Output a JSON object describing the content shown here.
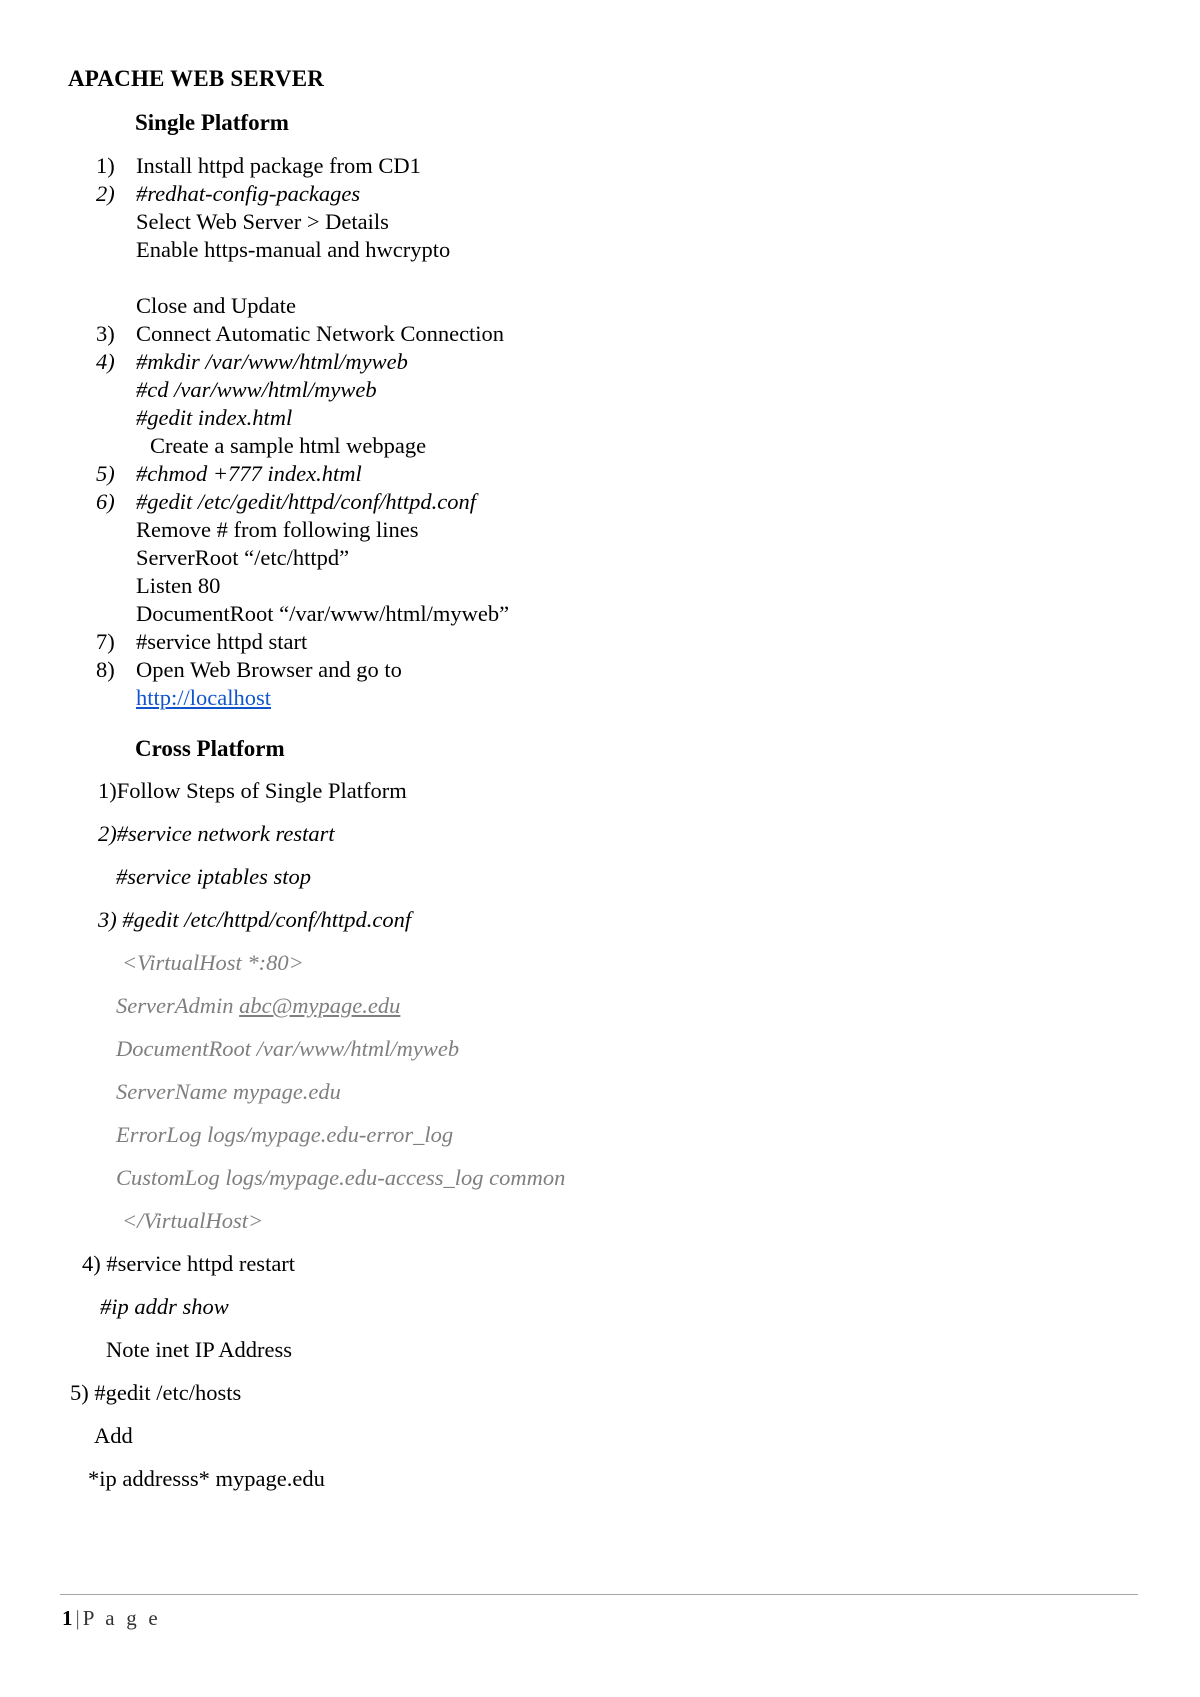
{
  "document": {
    "title": "APACHE WEB SERVER"
  },
  "sections": {
    "single": {
      "heading": "Single Platform",
      "items": [
        {
          "marker": "1)",
          "lines": [
            {
              "text": "Install httpd package from CD1",
              "style": "roman"
            }
          ]
        },
        {
          "marker": "2)",
          "lines": [
            {
              "text": "#redhat-config-packages",
              "style": "italic"
            },
            {
              "text": "Select Web Server > Details",
              "style": "roman"
            },
            {
              "text": "Enable https-manual and hwcrypto",
              "style": "roman"
            },
            {
              "text": "",
              "style": "blank"
            },
            {
              "text": "Close and Update",
              "style": "roman"
            }
          ]
        },
        {
          "marker": "3)",
          "lines": [
            {
              "text": "Connect Automatic Network Connection",
              "style": "roman"
            }
          ]
        },
        {
          "marker": "4)",
          "lines": [
            {
              "text": "#mkdir /var/www/html/myweb",
              "style": "italic"
            },
            {
              "text": "#cd /var/www/html/myweb",
              "style": "italic"
            },
            {
              "text": "#gedit index.html",
              "style": "italic"
            },
            {
              "text": "Create a sample html webpage",
              "style": "roman-indent"
            }
          ]
        },
        {
          "marker": "5)",
          "lines": [
            {
              "text": "#chmod +777 index.html",
              "style": "italic"
            }
          ]
        },
        {
          "marker": "6)",
          "lines": [
            {
              "text": "#gedit /etc/gedit/httpd/conf/httpd.conf",
              "style": "italic"
            },
            {
              "text": "Remove # from following lines",
              "style": "roman"
            },
            {
              "text": "ServerRoot “/etc/httpd”",
              "style": "roman"
            },
            {
              "text": "Listen 80",
              "style": "roman"
            },
            {
              "text": "DocumentRoot “/var/www/html/myweb”",
              "style": "roman"
            }
          ]
        },
        {
          "marker": "7)",
          "lines": [
            {
              "text": "#service httpd start",
              "style": "roman"
            }
          ]
        },
        {
          "marker": "8)",
          "lines": [
            {
              "text": "Open Web Browser and go to",
              "style": "roman"
            },
            {
              "text": "http://localhost",
              "style": "link"
            }
          ]
        }
      ]
    },
    "cross": {
      "heading": "Cross Platform",
      "lines": [
        {
          "text": "1)Follow Steps of Single Platform",
          "style": "roman",
          "indent": 30
        },
        {
          "text": "2)#service network restart",
          "style": "italic",
          "indent": 30
        },
        {
          "text": "#service iptables stop",
          "style": "italic",
          "indent": 48
        },
        {
          "text": "3) #gedit /etc/httpd/conf/httpd.conf",
          "style": "italic",
          "indent": 30
        },
        {
          "text": "<VirtualHost *:80>",
          "style": "gray",
          "indent": 54
        },
        {
          "text": "ServerAdmin abc@mypage.edu",
          "style": "gray-mail",
          "indent": 48,
          "link_text": "abc@mypage.edu",
          "prefix": "ServerAdmin "
        },
        {
          "text": "DocumentRoot /var/www/html/myweb",
          "style": "gray",
          "indent": 48
        },
        {
          "text": "ServerName mypage.edu",
          "style": "gray",
          "indent": 48
        },
        {
          "text": "ErrorLog logs/mypage.edu-error_log",
          "style": "gray",
          "indent": 48
        },
        {
          "text": "CustomLog logs/mypage.edu-access_log common",
          "style": "gray",
          "indent": 48
        },
        {
          "text": "</VirtualHost>",
          "style": "gray",
          "indent": 54
        },
        {
          "text": "4) #service httpd restart",
          "style": "roman",
          "indent": 14
        },
        {
          "text": "#ip addr show",
          "style": "italic",
          "indent": 32
        },
        {
          "text": "Note inet IP Address",
          "style": "roman",
          "indent": 38
        },
        {
          "text": "5) #gedit /etc/hosts",
          "style": "roman",
          "indent": 2
        },
        {
          "text": "Add",
          "style": "roman",
          "indent": 26
        },
        {
          "text": "*ip addresss* mypage.edu",
          "style": "roman",
          "indent": 20
        }
      ]
    }
  },
  "footer": {
    "page_number": "1",
    "separator": "|",
    "page_word": "P a g e"
  }
}
